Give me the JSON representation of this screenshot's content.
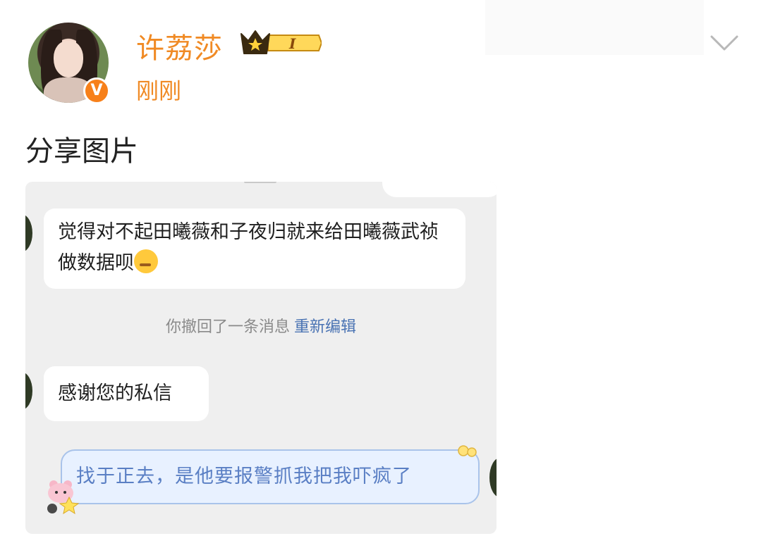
{
  "post": {
    "username": "许荔莎",
    "level_badge": "I",
    "timestamp": "刚刚",
    "caption": "分享图片"
  },
  "icons": {
    "verified": "V",
    "chevron": "chevron-down-icon",
    "crown": "crown-icon"
  },
  "colors": {
    "username": "#f08a24",
    "verified_badge": "#f7801a",
    "chat_background": "#efefef",
    "outgoing_bubble": "#e8f1ff",
    "link": "#4a73b3"
  },
  "chat": {
    "messages": [
      {
        "text": "觉得对不起田曦薇和子夜归就来给田曦薇武祯做数据呗"
      },
      {
        "text": "感谢您的私信"
      }
    ],
    "system_note": "你撤回了一条消息",
    "system_action": "重新编辑",
    "outgoing": "找于正去，是他要报警抓我把我吓疯了"
  }
}
